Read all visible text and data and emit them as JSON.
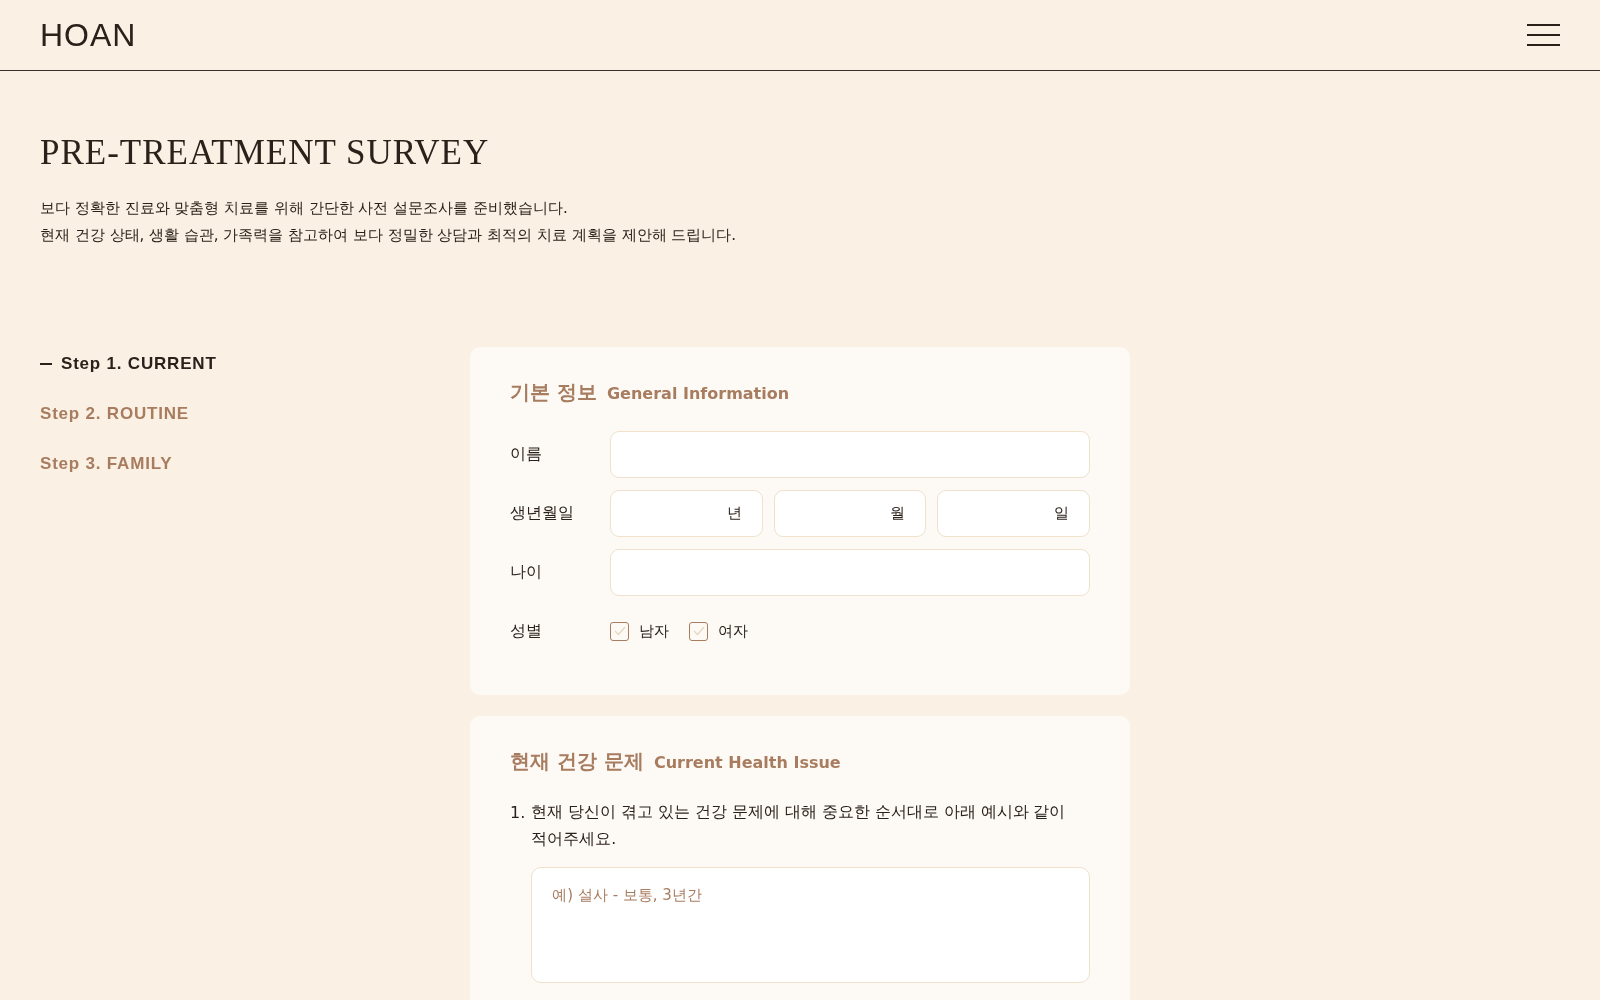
{
  "header": {
    "logo": "HOAN"
  },
  "page": {
    "title": "PRE-TREATMENT SURVEY",
    "description": [
      "보다 정확한 진료와 맞춤형 치료를 위해 간단한 사전 설문조사를 준비했습니다.",
      "현재 건강 상태, 생활 습관, 가족력을 참고하여 보다 정밀한 상담과 최적의 치료 계획을 제안해 드립니다."
    ]
  },
  "steps": [
    {
      "label": "Step 1. CURRENT",
      "selected": true
    },
    {
      "label": "Step 2. ROUTINE",
      "selected": false
    },
    {
      "label": "Step 3. FAMILY",
      "selected": false
    }
  ],
  "sections": [
    {
      "title": "기본 정보",
      "subtitle": "General Information",
      "rows": [
        {
          "kind": "text",
          "label": "이름"
        },
        {
          "kind": "date",
          "label": "생년월일",
          "units": [
            "년",
            "월",
            "일"
          ]
        },
        {
          "kind": "text",
          "label": "나이"
        },
        {
          "kind": "checks",
          "label": "성별",
          "options": [
            {
              "label": "남자",
              "checked": false
            },
            {
              "label": "여자",
              "checked": false
            }
          ]
        }
      ]
    },
    {
      "title": "현재 건강 문제",
      "subtitle": "Current Health Issue",
      "questions": [
        {
          "number": "1.",
          "text": "현재 당신이 겪고 있는 건강 문제에 대해 중요한 순서대로 아래 예시와 같이 적어주세요.",
          "placeholder": "예) 설사 - 보통, 3년간"
        }
      ]
    }
  ]
}
